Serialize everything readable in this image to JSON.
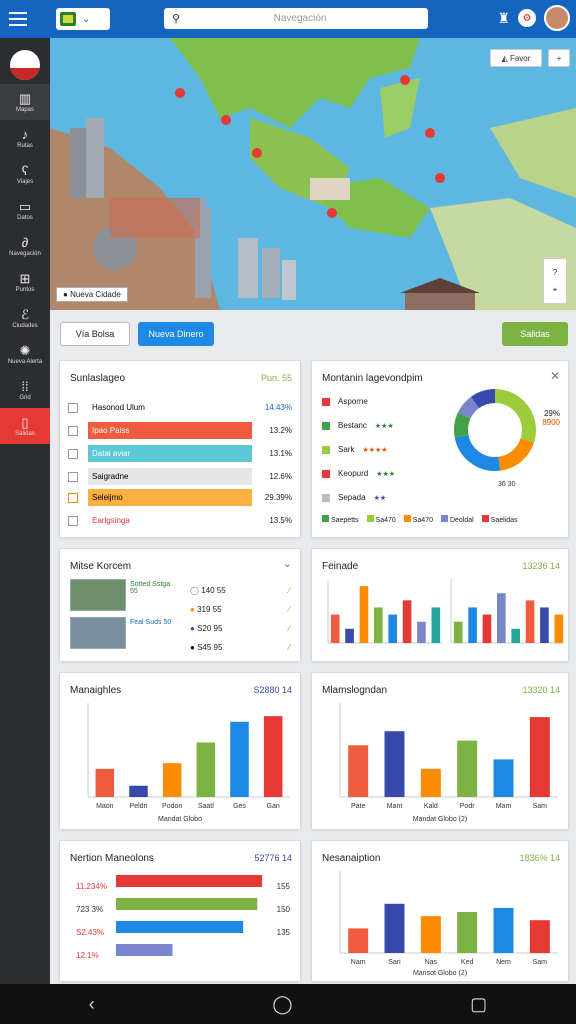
{
  "header": {
    "search_placeholder": "Navegación"
  },
  "sidebar": {
    "items": [
      {
        "label": "Mapas",
        "icon": "buildings-icon"
      },
      {
        "label": "Rutas",
        "icon": "route-icon"
      },
      {
        "label": "Viajes",
        "icon": "travel-icon"
      },
      {
        "label": "Datos",
        "icon": "data-icon"
      },
      {
        "label": "Navegación",
        "icon": "navigation-icon"
      },
      {
        "label": "Puntos",
        "icon": "points-icon"
      },
      {
        "label": "Ciudades",
        "icon": "cities-icon"
      },
      {
        "label": "Nueva Alerta",
        "icon": "alert-icon"
      },
      {
        "label": "Grid",
        "icon": "grid-icon"
      },
      {
        "label": "Salidas",
        "icon": "exit-icon"
      }
    ]
  },
  "map": {
    "btn_label": "Favor",
    "caption": "Nueva Cidade"
  },
  "toolbar": {
    "select_label": "Vía Bolsa",
    "primary_label": "Nueva Dinero",
    "action_label": "Salidas"
  },
  "card1": {
    "title": "Sunlaslageo",
    "value": "Pun. 55",
    "rows": [
      {
        "label": "Hasonod Ulum",
        "value": "14.43%"
      },
      {
        "label": "Ipao Paiss",
        "value": "13.2%"
      },
      {
        "label": "Datai aviar",
        "value": "13.1%"
      },
      {
        "label": "Saigradne",
        "value": "12.6%"
      },
      {
        "label": "Seleijmo",
        "value": "29.39%"
      },
      {
        "label": "Earlgsinga",
        "value": "13.5%"
      }
    ]
  },
  "card2": {
    "title": "Montanin lagevondpim",
    "legend": [
      {
        "label": "Asporne",
        "color": "#e53935"
      },
      {
        "label": "Bestanc",
        "color": "#43a047"
      },
      {
        "label": "Sark",
        "color": "#9ccc3c"
      },
      {
        "label": "Keopurd",
        "color": "#e53935"
      },
      {
        "label": "Sepada",
        "color": "#bdbdbd"
      }
    ],
    "bottom_legend": [
      "Saepetts",
      "Sa470",
      "Sa470",
      "Deoldal",
      "Saelidas"
    ],
    "pct_label": "29%",
    "pct_value": "8900",
    "pct_bottom": "36 30",
    "donut": [
      {
        "value": 30,
        "color": "#9ccc3c"
      },
      {
        "value": 18,
        "color": "#fb8c00"
      },
      {
        "value": 24,
        "color": "#1e88e5"
      },
      {
        "value": 10,
        "color": "#43a047"
      },
      {
        "value": 8,
        "color": "#7986cb"
      },
      {
        "value": 10,
        "color": "#3949ab"
      }
    ]
  },
  "card3": {
    "title": "Mitse Korcem",
    "places": [
      {
        "name": "Sotted Sstga 55"
      },
      {
        "name": "Feal Suds 50"
      }
    ],
    "stats": [
      {
        "value": "140 55",
        "color": "#43a047"
      },
      {
        "value": "319 55",
        "color": "#fb8c00"
      },
      {
        "value": "S20 95",
        "color": "#3949ab"
      },
      {
        "value": "S45 95",
        "color": "#111"
      }
    ]
  },
  "card4": {
    "title": "Feinade",
    "value": "13236 14"
  },
  "card5": {
    "title": "Manaighles",
    "value": "S2880 14",
    "footer": "Mandat Globo"
  },
  "card6": {
    "title": "Mlamslogndan",
    "value": "13320 14",
    "footer": "Mandat Globo (2)"
  },
  "card7": {
    "title": "Nertion Maneolons",
    "value": "52776 14",
    "rows": [
      {
        "label": "11.234%",
        "value": "155"
      },
      {
        "label": "723 3%",
        "value": "150"
      },
      {
        "label": "S2.43%",
        "value": "135"
      },
      {
        "label": "12.1%",
        "value": ""
      }
    ]
  },
  "card8": {
    "title": "Nesanaiption",
    "value": "1836% 14",
    "footer": "Mansot Globo (2)"
  },
  "chart_data": [
    {
      "type": "bar",
      "title": "Feinade",
      "series": [
        {
          "values": [
            4,
            2,
            8,
            5,
            4,
            6,
            3,
            5
          ]
        },
        {
          "values": [
            3,
            5,
            4,
            7,
            2,
            6,
            5,
            4
          ]
        }
      ]
    },
    {
      "type": "bar",
      "title": "Manaighles",
      "categories": [
        "Maon",
        "Peldn",
        "Podon",
        "Saatl",
        "Ges",
        "Gan"
      ],
      "values": [
        30,
        12,
        36,
        58,
        80,
        86
      ],
      "ylim": [
        0,
        100
      ]
    },
    {
      "type": "bar",
      "title": "Mlamslogndan",
      "categories": [
        "Pate",
        "Mant",
        "Kald",
        "Podr",
        "Mam",
        "Sam"
      ],
      "values": [
        55,
        70,
        30,
        60,
        40,
        85
      ],
      "ylim": [
        0,
        100
      ]
    },
    {
      "type": "bar",
      "title": "Nertion Maneolons",
      "orientation": "horizontal",
      "values": [
        155,
        150,
        135,
        60
      ]
    },
    {
      "type": "bar",
      "title": "Nesanaiption",
      "categories": [
        "Nam",
        "Sari",
        "Nas",
        "Ked",
        "Nem",
        "Sam"
      ],
      "values": [
        30,
        60,
        45,
        50,
        55,
        40
      ],
      "ylim": [
        0,
        100
      ]
    }
  ]
}
